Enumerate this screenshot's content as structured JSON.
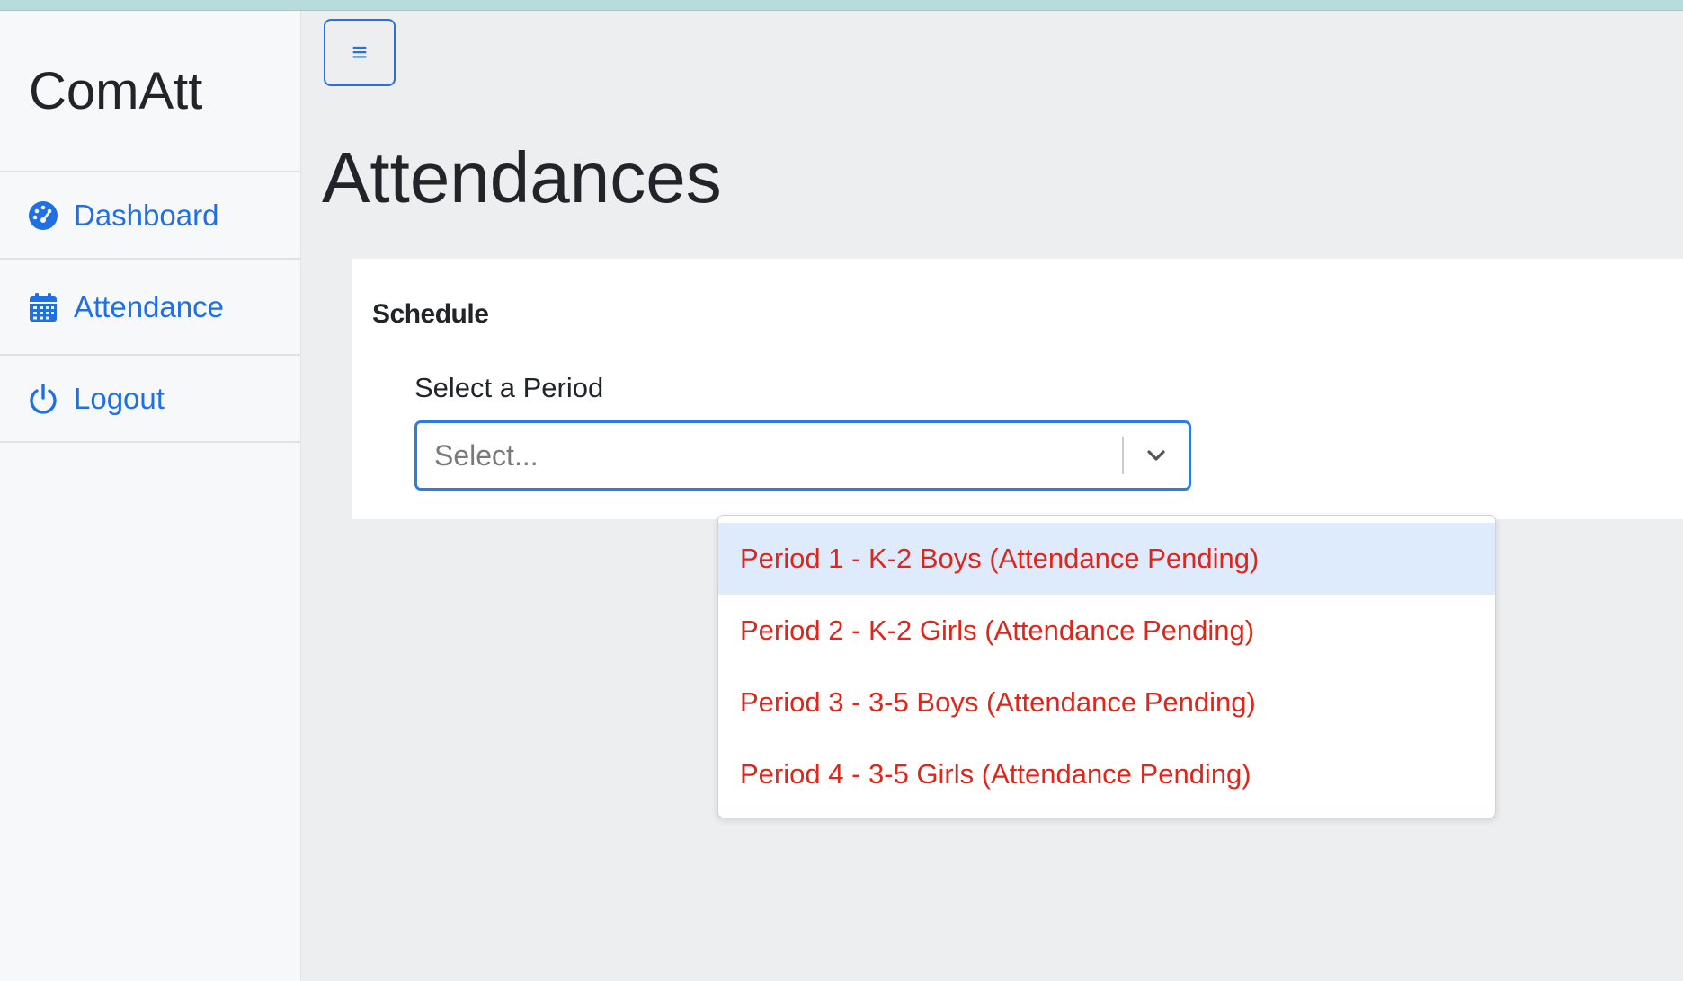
{
  "app": {
    "brand": "ComAtt"
  },
  "sidebar": {
    "items": [
      {
        "label": "Dashboard",
        "icon": "dashboard-gauge-icon"
      },
      {
        "label": "Attendance",
        "icon": "calendar-icon"
      },
      {
        "label": "Logout",
        "icon": "power-icon"
      }
    ]
  },
  "header": {
    "toggle_icon": "hamburger-menu-icon",
    "toggle_glyph": "≡"
  },
  "page": {
    "title": "Attendances"
  },
  "card": {
    "title": "Schedule",
    "field_label": "Select a Period",
    "select": {
      "placeholder": "Select...",
      "arrow_icon": "chevron-down-icon"
    },
    "options": [
      {
        "label": "Period 1 - K-2 Boys (Attendance Pending)",
        "focused": true
      },
      {
        "label": "Period 2 - K-2 Girls (Attendance Pending)",
        "focused": false
      },
      {
        "label": "Period 3 - 3-5 Boys (Attendance Pending)",
        "focused": false
      },
      {
        "label": "Period 4 - 3-5 Girls (Attendance Pending)",
        "focused": false
      }
    ]
  },
  "colors": {
    "accent": "#1f6fe5",
    "option_text": "#e0261b",
    "option_focus_bg": "#deebfd",
    "topbar": "#b8dcdc"
  }
}
